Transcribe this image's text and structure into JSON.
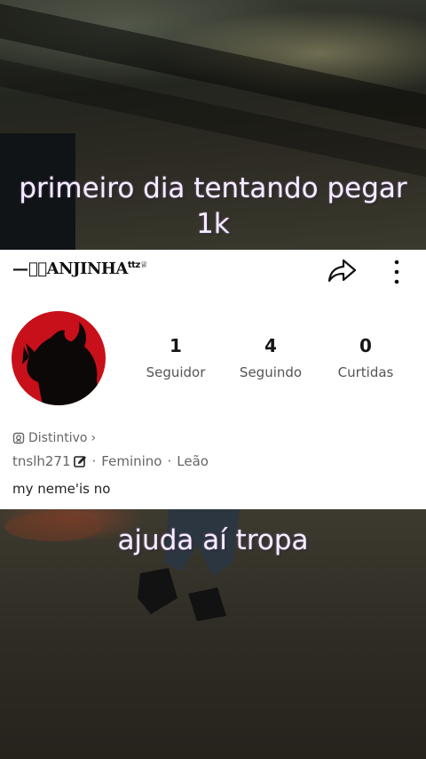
{
  "video": {
    "caption_top": "primeiro dia tentando pegar 1k",
    "caption_bottom": "ajuda aí tropa"
  },
  "profile": {
    "username_display": "—⃥★ANJINHA",
    "username_suffix": "ttz♕",
    "stats": [
      {
        "value": "1",
        "label": "Seguidor"
      },
      {
        "value": "4",
        "label": "Seguindo"
      },
      {
        "value": "0",
        "label": "Curtidas"
      }
    ],
    "badge_label": "Distintivo",
    "badge_chevron": "›",
    "handle": "tnslh271",
    "gender": "Feminino",
    "sign": "Leão",
    "separator": "·",
    "bio": "my neme'is no"
  },
  "icons": {
    "share": "share-arrow-icon",
    "more": "more-vertical-icon",
    "edit": "edit-icon",
    "badge": "badge-icon"
  },
  "colors": {
    "avatar_bg": "#c8101a",
    "caption_text": "#f4eefb"
  }
}
